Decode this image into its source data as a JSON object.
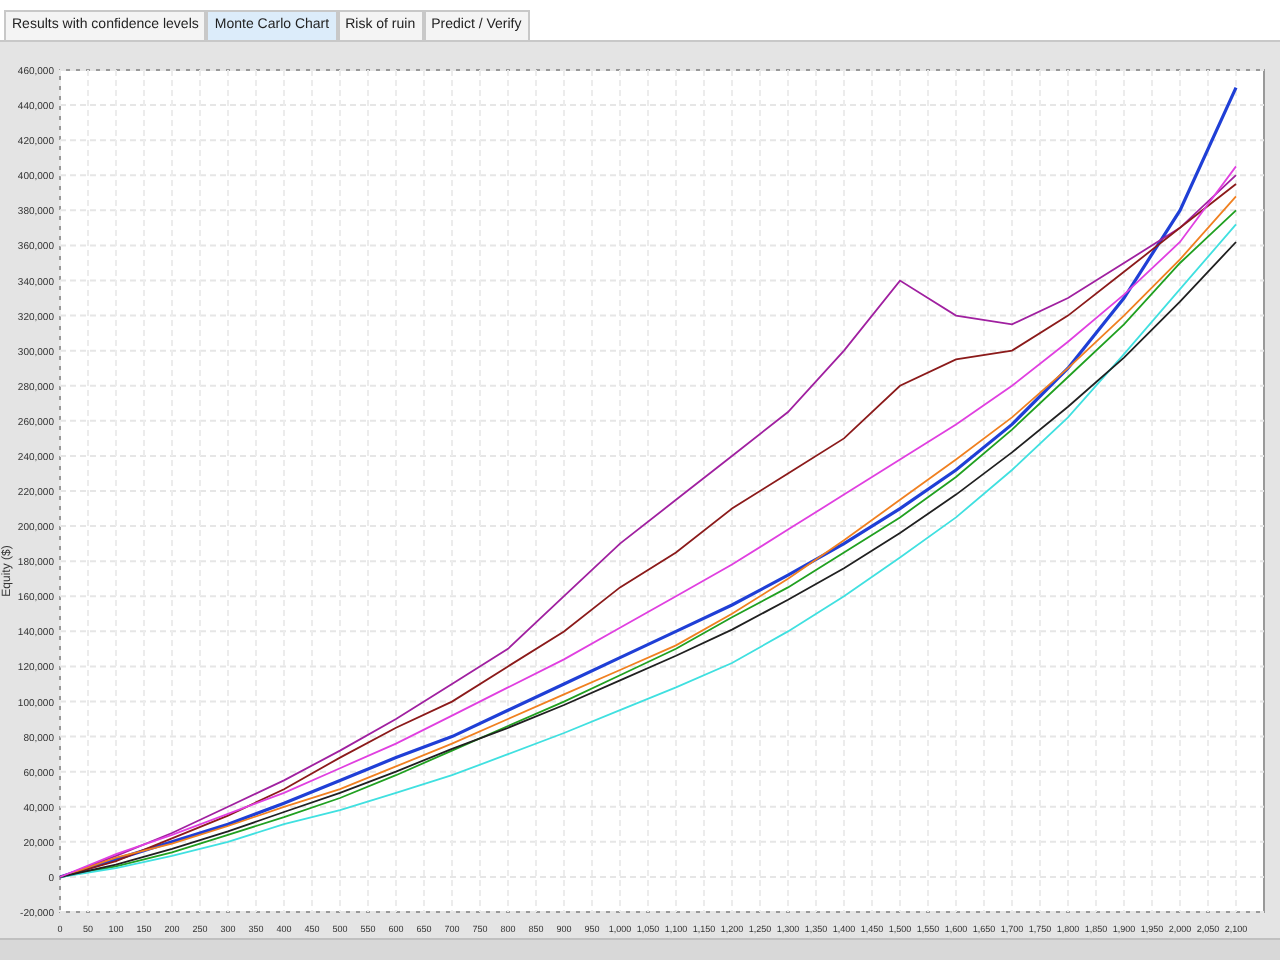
{
  "tabs": [
    {
      "label": "Results with confidence levels",
      "selected": false
    },
    {
      "label": "Monte Carlo Chart",
      "selected": true
    },
    {
      "label": "Risk of ruin",
      "selected": false
    },
    {
      "label": "Predict / Verify",
      "selected": false
    }
  ],
  "chart": {
    "chart_data": {
      "type": "line",
      "ylabel": "Equity ($)",
      "grid": true,
      "x": [
        0,
        100,
        200,
        300,
        400,
        500,
        600,
        700,
        800,
        900,
        1000,
        1100,
        1200,
        1300,
        1400,
        1500,
        1600,
        1700,
        1800,
        1900,
        2000,
        2100
      ],
      "xlim": [
        0,
        2150
      ],
      "ylim": [
        -20000,
        460000
      ],
      "xticks": [
        {
          "value": 0,
          "label": "0"
        },
        {
          "value": 50,
          "label": "50"
        },
        {
          "value": 100,
          "label": "100"
        },
        {
          "value": 150,
          "label": "150"
        },
        {
          "value": 200,
          "label": "200"
        },
        {
          "value": 250,
          "label": "250"
        },
        {
          "value": 300,
          "label": "300"
        },
        {
          "value": 350,
          "label": "350"
        },
        {
          "value": 400,
          "label": "400"
        },
        {
          "value": 450,
          "label": "450"
        },
        {
          "value": 500,
          "label": "500"
        },
        {
          "value": 550,
          "label": "550"
        },
        {
          "value": 600,
          "label": "600"
        },
        {
          "value": 650,
          "label": "650"
        },
        {
          "value": 700,
          "label": "700"
        },
        {
          "value": 750,
          "label": "750"
        },
        {
          "value": 800,
          "label": "800"
        },
        {
          "value": 850,
          "label": "850"
        },
        {
          "value": 900,
          "label": "900"
        },
        {
          "value": 950,
          "label": "950"
        },
        {
          "value": 1000,
          "label": "1,000"
        },
        {
          "value": 1050,
          "label": "1,050"
        },
        {
          "value": 1100,
          "label": "1,100"
        },
        {
          "value": 1150,
          "label": "1,150"
        },
        {
          "value": 1200,
          "label": "1,200"
        },
        {
          "value": 1250,
          "label": "1,250"
        },
        {
          "value": 1300,
          "label": "1,300"
        },
        {
          "value": 1350,
          "label": "1,350"
        },
        {
          "value": 1400,
          "label": "1,400"
        },
        {
          "value": 1450,
          "label": "1,450"
        },
        {
          "value": 1500,
          "label": "1,500"
        },
        {
          "value": 1550,
          "label": "1,550"
        },
        {
          "value": 1600,
          "label": "1,600"
        },
        {
          "value": 1650,
          "label": "1,650"
        },
        {
          "value": 1700,
          "label": "1,700"
        },
        {
          "value": 1750,
          "label": "1,750"
        },
        {
          "value": 1800,
          "label": "1,800"
        },
        {
          "value": 1850,
          "label": "1,850"
        },
        {
          "value": 1900,
          "label": "1,900"
        },
        {
          "value": 1950,
          "label": "1,950"
        },
        {
          "value": 2000,
          "label": "2,000"
        },
        {
          "value": 2050,
          "label": "2,050"
        },
        {
          "value": 2100,
          "label": "2,100"
        }
      ],
      "yticks": [
        {
          "value": -20000,
          "label": "-20,000"
        },
        {
          "value": 0,
          "label": "0"
        },
        {
          "value": 20000,
          "label": "20,000"
        },
        {
          "value": 40000,
          "label": "40,000"
        },
        {
          "value": 60000,
          "label": "60,000"
        },
        {
          "value": 80000,
          "label": "80,000"
        },
        {
          "value": 100000,
          "label": "100,000"
        },
        {
          "value": 120000,
          "label": "120,000"
        },
        {
          "value": 140000,
          "label": "140,000"
        },
        {
          "value": 160000,
          "label": "160,000"
        },
        {
          "value": 180000,
          "label": "180,000"
        },
        {
          "value": 200000,
          "label": "200,000"
        },
        {
          "value": 220000,
          "label": "220,000"
        },
        {
          "value": 240000,
          "label": "240,000"
        },
        {
          "value": 260000,
          "label": "260,000"
        },
        {
          "value": 280000,
          "label": "280,000"
        },
        {
          "value": 300000,
          "label": "300,000"
        },
        {
          "value": 320000,
          "label": "320,000"
        },
        {
          "value": 340000,
          "label": "340,000"
        },
        {
          "value": 360000,
          "label": "360,000"
        },
        {
          "value": 380000,
          "label": "380,000"
        },
        {
          "value": 400000,
          "label": "400,000"
        },
        {
          "value": 420000,
          "label": "420,000"
        },
        {
          "value": 440000,
          "label": "440,000"
        },
        {
          "value": 460000,
          "label": "460,000"
        }
      ],
      "series": [
        {
          "color": "#1f3fd6",
          "values": [
            0,
            10000,
            20000,
            30000,
            42000,
            55000,
            68000,
            80000,
            95000,
            110000,
            125000,
            140000,
            155000,
            172000,
            190000,
            210000,
            232000,
            258000,
            290000,
            330000,
            380000,
            450000
          ]
        },
        {
          "color": "#a020a0",
          "values": [
            0,
            12000,
            25000,
            40000,
            55000,
            72000,
            90000,
            110000,
            130000,
            160000,
            190000,
            215000,
            240000,
            265000,
            300000,
            340000,
            320000,
            315000,
            330000,
            350000,
            370000,
            400000
          ]
        },
        {
          "color": "#8b1a1a",
          "values": [
            0,
            9000,
            22000,
            35000,
            50000,
            68000,
            85000,
            100000,
            120000,
            140000,
            165000,
            185000,
            210000,
            230000,
            250000,
            280000,
            295000,
            300000,
            320000,
            345000,
            370000,
            395000
          ]
        },
        {
          "color": "#20a020",
          "values": [
            0,
            6000,
            14000,
            24000,
            34000,
            45000,
            58000,
            72000,
            86000,
            100000,
            115000,
            130000,
            148000,
            165000,
            185000,
            205000,
            228000,
            255000,
            285000,
            315000,
            350000,
            380000
          ]
        },
        {
          "color": "#40e0e0",
          "values": [
            0,
            5000,
            12000,
            20000,
            30000,
            38000,
            48000,
            58000,
            70000,
            82000,
            95000,
            108000,
            122000,
            140000,
            160000,
            182000,
            205000,
            232000,
            262000,
            298000,
            335000,
            372000
          ]
        },
        {
          "color": "#f08020",
          "values": [
            0,
            11000,
            19000,
            29000,
            40000,
            50000,
            63000,
            76000,
            90000,
            104000,
            118000,
            132000,
            150000,
            170000,
            192000,
            215000,
            238000,
            262000,
            290000,
            320000,
            352000,
            388000
          ]
        },
        {
          "color": "#202020",
          "values": [
            0,
            7000,
            16000,
            26000,
            37000,
            48000,
            60000,
            73000,
            85000,
            98000,
            112000,
            126000,
            141000,
            158000,
            176000,
            196000,
            218000,
            242000,
            268000,
            296000,
            328000,
            362000
          ]
        },
        {
          "color": "#e040e0",
          "values": [
            0,
            13000,
            24000,
            36000,
            48000,
            62000,
            76000,
            92000,
            108000,
            124000,
            142000,
            160000,
            178000,
            198000,
            218000,
            238000,
            258000,
            280000,
            305000,
            332000,
            362000,
            405000
          ]
        }
      ]
    }
  }
}
